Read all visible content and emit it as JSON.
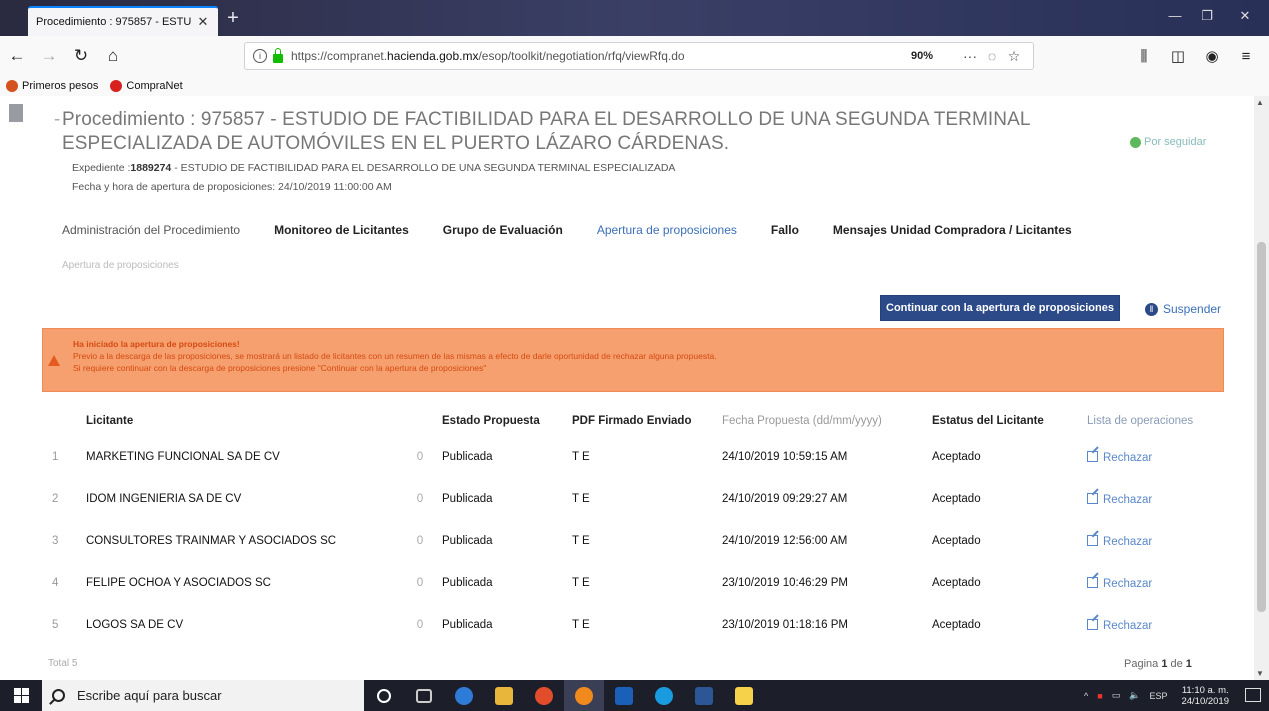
{
  "browser": {
    "tab_title": "Procedimiento : 975857 - ESTU",
    "tab_close": "✕",
    "new_tab": "+",
    "url_prefix": "https://compranet.",
    "url_domain": "hacienda.gob.mx",
    "url_path": "/esop/toolkit/negotiation/rfq/viewRfq.do",
    "zoom": "90%",
    "bookmarks": [
      "Primeros pesos",
      "CompraNet"
    ]
  },
  "header": {
    "title_line1": "Procedimiento : 975857 - ESTUDIO DE FACTIBILIDAD PARA EL DESARROLLO DE UNA SEGUNDA TERMINAL",
    "title_line2": "ESPECIALIZADA DE AUTOMÓVILES EN EL PUERTO LÁZARO CÁRDENAS.",
    "follow_label": "Por seguidar",
    "expediente_label": "Expediente :",
    "expediente_number": "1889274",
    "expediente_desc": " - ESTUDIO DE FACTIBILIDAD PARA EL DESARROLLO DE UNA SEGUNDA TERMINAL ESPECIALIZADA",
    "opening_date": "Fecha y hora de apertura de proposiciones: 24/10/2019 11:00:00 AM"
  },
  "nav_tabs": [
    "Administración del Procedimiento",
    "Monitoreo de Licitantes",
    "Grupo de Evaluación",
    "Apertura de proposiciones",
    "Fallo",
    "Mensajes Unidad Compradora / Licitantes"
  ],
  "breadcrumb": "Apertura de proposiciones",
  "actions": {
    "continue_label": "Continuar con la apertura de proposiciones",
    "suspend_label": "Suspender"
  },
  "alert": {
    "line1": "Ha iniciado la apertura de proposiciones!",
    "line2": "Previo a la descarga de las proposiciones, se mostrará un listado de licitantes con un resumen de las mismas a efecto de darle oportunidad de rechazar alguna propuesta.",
    "line3": "Si requiere continuar con la descarga de proposiciones presione \"Continuar con la apertura de proposiciones\""
  },
  "table": {
    "headers": [
      "Licitante",
      "Estado Propuesta",
      "PDF Firmado Enviado",
      "Fecha Propuesta (dd/mm/yyyy)",
      "Estatus del Licitante",
      "Lista de operaciones"
    ],
    "rows": [
      {
        "n": "1",
        "name": "MARKETING FUNCIONAL SA DE CV",
        "zero": "0",
        "status": "Publicada",
        "pdf": "T E",
        "date": "24/10/2019 10:59:15 AM",
        "state": "Aceptado",
        "action": "Rechazar"
      },
      {
        "n": "2",
        "name": "IDOM INGENIERIA SA DE CV",
        "zero": "0",
        "status": "Publicada",
        "pdf": "T E",
        "date": "24/10/2019 09:29:27 AM",
        "state": "Aceptado",
        "action": "Rechazar"
      },
      {
        "n": "3",
        "name": "CONSULTORES TRAINMAR Y ASOCIADOS SC",
        "zero": "0",
        "status": "Publicada",
        "pdf": "T E",
        "date": "24/10/2019 12:56:00 AM",
        "state": "Aceptado",
        "action": "Rechazar"
      },
      {
        "n": "4",
        "name": "FELIPE OCHOA Y ASOCIADOS SC",
        "zero": "0",
        "status": "Publicada",
        "pdf": "T E",
        "date": "23/10/2019 10:46:29 PM",
        "state": "Aceptado",
        "action": "Rechazar"
      },
      {
        "n": "5",
        "name": "LOGOS SA DE CV",
        "zero": "0",
        "status": "Publicada",
        "pdf": "T E",
        "date": "23/10/2019 01:18:16 PM",
        "state": "Aceptado",
        "action": "Rechazar"
      }
    ]
  },
  "footer": {
    "total": "Total 5",
    "page_prefix": "Pagina ",
    "page_current": "1",
    "page_mid": " de ",
    "page_total": "1"
  },
  "taskbar": {
    "search_placeholder": "Escribe aquí para buscar",
    "lang": "ESP",
    "time": "11:10 a. m.",
    "date": "24/10/2019"
  },
  "colors": {
    "primary": "#2c4a88",
    "alert_bg": "#f5a06e",
    "link": "#3b6fb6"
  }
}
